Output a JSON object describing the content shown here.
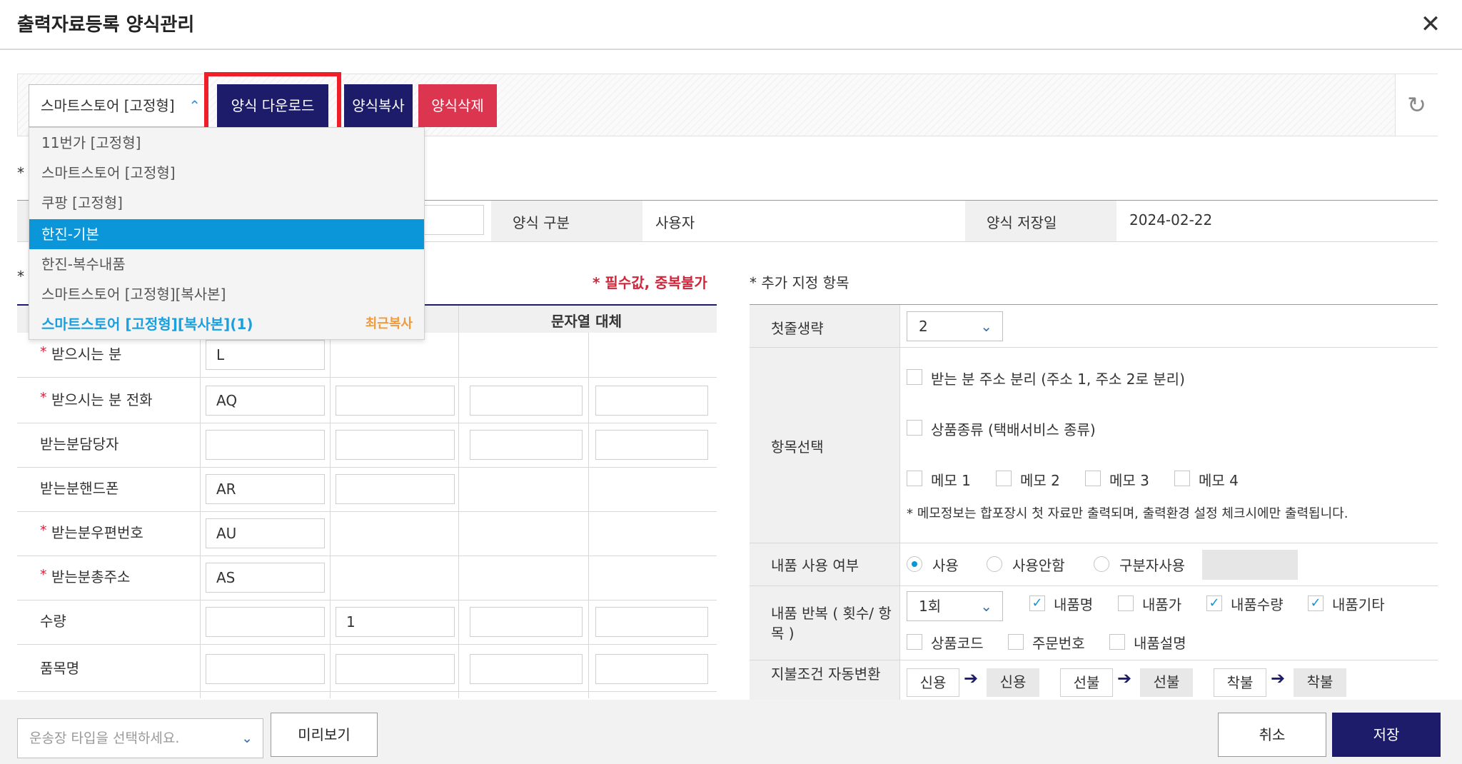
{
  "title": "출력자료등록 양식관리",
  "toolbar": {
    "form_select": "스마트스토어 [고정형]",
    "download_label": "양식 다운로드",
    "copy_label": "양식복사",
    "delete_label": "양식삭제"
  },
  "dropdown": {
    "items": [
      "11번가 [고정형]",
      "스마트스토어 [고정형]",
      "쿠팡 [고정형]",
      "한진-기본",
      "한진-복수내품",
      "스마트스토어 [고정형][복사본]",
      "스마트스토어 [고정형][복사본](1)"
    ],
    "recent_tag": "최근복사"
  },
  "info": {
    "type_label": "양식 구분",
    "type_value": "사용자",
    "date_label": "양식 저장일",
    "date_value": "2024-02-22"
  },
  "left": {
    "required_note": "* 필수값, 중복불가",
    "col_header": "문자열 대체",
    "rows": [
      {
        "label": "받으시는 분",
        "req": "*",
        "v1": "L",
        "v2": ""
      },
      {
        "label": "받으시는 분 전화",
        "req": "*",
        "v1": "AQ",
        "v2": ""
      },
      {
        "label": "받는분담당자",
        "req": "",
        "v1": "",
        "v2": ""
      },
      {
        "label": "받는분핸드폰",
        "req": "",
        "v1": "AR",
        "v2": ""
      },
      {
        "label": "받는분우편번호",
        "req": "*",
        "v1": "AU",
        "v2": ""
      },
      {
        "label": "받는분총주소",
        "req": "*",
        "v1": "AS",
        "v2": ""
      },
      {
        "label": "수량",
        "req": "",
        "v1": "",
        "v2": "1"
      },
      {
        "label": "품목명",
        "req": "",
        "v1": "",
        "v2": ""
      }
    ]
  },
  "right": {
    "section_title": "* 추가 지정 항목",
    "skip_label": "첫줄생략",
    "skip_value": "2",
    "items_label": "항목선택",
    "opt_addr": "받는 분 주소 분리 (주소 1, 주소 2로 분리)",
    "opt_kind": "상품종류 (택배서비스 종류)",
    "memos": [
      "메모 1",
      "메모 2",
      "메모 3",
      "메모 4"
    ],
    "memo_note": "* 메모정보는 합포장시 첫 자료만 출력되며, 출력환경 설정 체크시에만 출력됩니다.",
    "content_use_label": "내품 사용 여부",
    "radios": [
      "사용",
      "사용안함",
      "구분자사용"
    ],
    "repeat_label": "내품 반복 ( 횟수/ 항목 )",
    "repeat_value": "1회",
    "repeat_checks": [
      "내품명",
      "내품가",
      "내품수량",
      "내품기타"
    ],
    "repeat_checks2": [
      "상품코드",
      "주문번호",
      "내품설명"
    ],
    "pay_label": "지불조건 자동변환",
    "pay_pairs": [
      [
        "신용",
        "신용"
      ],
      [
        "선불",
        "선불"
      ],
      [
        "착불",
        "착불"
      ]
    ]
  },
  "footer": {
    "waybill_placeholder": "운송장 타입을 선택하세요.",
    "preview_label": "미리보기",
    "cancel_label": "취소",
    "save_label": "저장"
  }
}
